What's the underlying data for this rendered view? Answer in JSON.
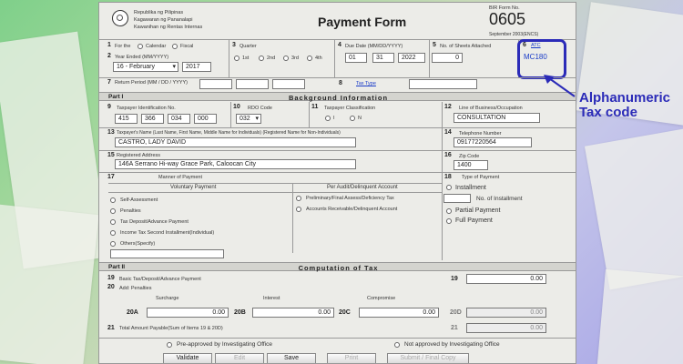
{
  "header": {
    "agency": [
      "Republika ng Pilipinas",
      "Kagawaran ng Pananalapi",
      "Kawanihan ng Rentas Internas"
    ],
    "title": "Payment Form",
    "bir_form_label": "BIR Form No.",
    "form_number": "0605",
    "version": "September 2003(ENCS)"
  },
  "items": {
    "i1": {
      "num": "1",
      "label": "For the",
      "options": [
        "Calendar",
        "Fiscal"
      ]
    },
    "i2": {
      "num": "2",
      "label": "Year Ended (MM/YYYY)",
      "month_value": "16 - February",
      "year_value": "2017"
    },
    "i3": {
      "num": "3",
      "label": "Quarter",
      "options": [
        "1st",
        "2nd",
        "3rd",
        "4th"
      ]
    },
    "i4": {
      "num": "4",
      "label": "Due Date (MM/DD/YYYY)",
      "mm": "01",
      "dd": "31",
      "yyyy": "2022"
    },
    "i5": {
      "num": "5",
      "label": "No. of Sheets Attached",
      "value": "0"
    },
    "i6": {
      "num": "6",
      "label": "ATC",
      "value": "MC180"
    },
    "i7": {
      "num": "7",
      "label": "Return Period (MM / DD / YYYY)"
    },
    "i8": {
      "num": "8",
      "label": "Tax Type"
    }
  },
  "part1": {
    "part_label": "Part I",
    "title": "Background Information",
    "i9": {
      "num": "9",
      "label": "Taxpayer Identification No.",
      "values": [
        "415",
        "366",
        "034",
        "000"
      ]
    },
    "i10": {
      "num": "10",
      "label": "RDO Code",
      "value": "032"
    },
    "i11": {
      "num": "11",
      "label": "Taxpayer Classification",
      "options": [
        "I",
        "N"
      ]
    },
    "i12": {
      "num": "12",
      "label": "Line of Business/Occupation",
      "value": "CONSULTATION"
    },
    "i13": {
      "num": "13",
      "label": "Taxpayer's Name (Last Name, First Name, Middle Name for Individuals) (Registered Name for Non-Individuals)",
      "value": "CASTRO, LADY DAVID"
    },
    "i14": {
      "num": "14",
      "label": "Telephone Number",
      "value": "09177220564"
    },
    "i15": {
      "num": "15",
      "label": "Registered Address",
      "value": "146A Serrano Hi-way Grace Park, Caloocan City"
    },
    "i16": {
      "num": "16",
      "label": "Zip Code",
      "value": "1400"
    },
    "i17": {
      "num": "17",
      "label": "Manner of Payment",
      "voluntary_title": "Voluntary Payment",
      "voluntary_options": [
        "Self-Assessment",
        "Penalties",
        "Tax Deposit/Advance Payment",
        "Income Tax Second Installment(Individual)",
        "Others(Specify)"
      ],
      "per_audit_title": "Per Audit/Delinquent Account",
      "per_audit_options": [
        "Preliminary/Final Assess/Deficiency Tax",
        "Accounts Receivable/Delinquent Account"
      ]
    },
    "i18": {
      "num": "18",
      "label": "Type of Payment",
      "installment": "Installment",
      "no_of_installment": "No. of Installment",
      "partial": "Partial Payment",
      "full": "Full Payment"
    }
  },
  "part2": {
    "part_label": "Part II",
    "title": "Computation of Tax",
    "i19": {
      "num": "19",
      "label": "Basic Tax/Deposit/Advance Payment",
      "value": "0.00"
    },
    "i20": {
      "num": "20",
      "label": "Add: Penalties",
      "surcharge": "Surcharge",
      "interest": "Interest",
      "compromise": "Compromise",
      "a": {
        "label": "20A",
        "value": "0.00"
      },
      "b": {
        "label": "20B",
        "value": "0.00"
      },
      "c": {
        "label": "20C",
        "value": "0.00"
      },
      "d": {
        "label": "20D",
        "value": "0.00"
      }
    },
    "i21": {
      "num": "21",
      "label": "Total Amount Payable(Sum of Items 19 & 20D)",
      "value": "0.00"
    }
  },
  "approval": {
    "pre": "Pre-approved by Investigating Office",
    "not": "Not approved by Investigating Office"
  },
  "buttons": {
    "validate": "Validate",
    "edit": "Edit",
    "save": "Save",
    "print": "Print",
    "submit": "Submit / Final Copy"
  },
  "annotation": {
    "text_line1": "Alphanumeric",
    "text_line2": "Tax code",
    "color": "#2b2bb8"
  }
}
